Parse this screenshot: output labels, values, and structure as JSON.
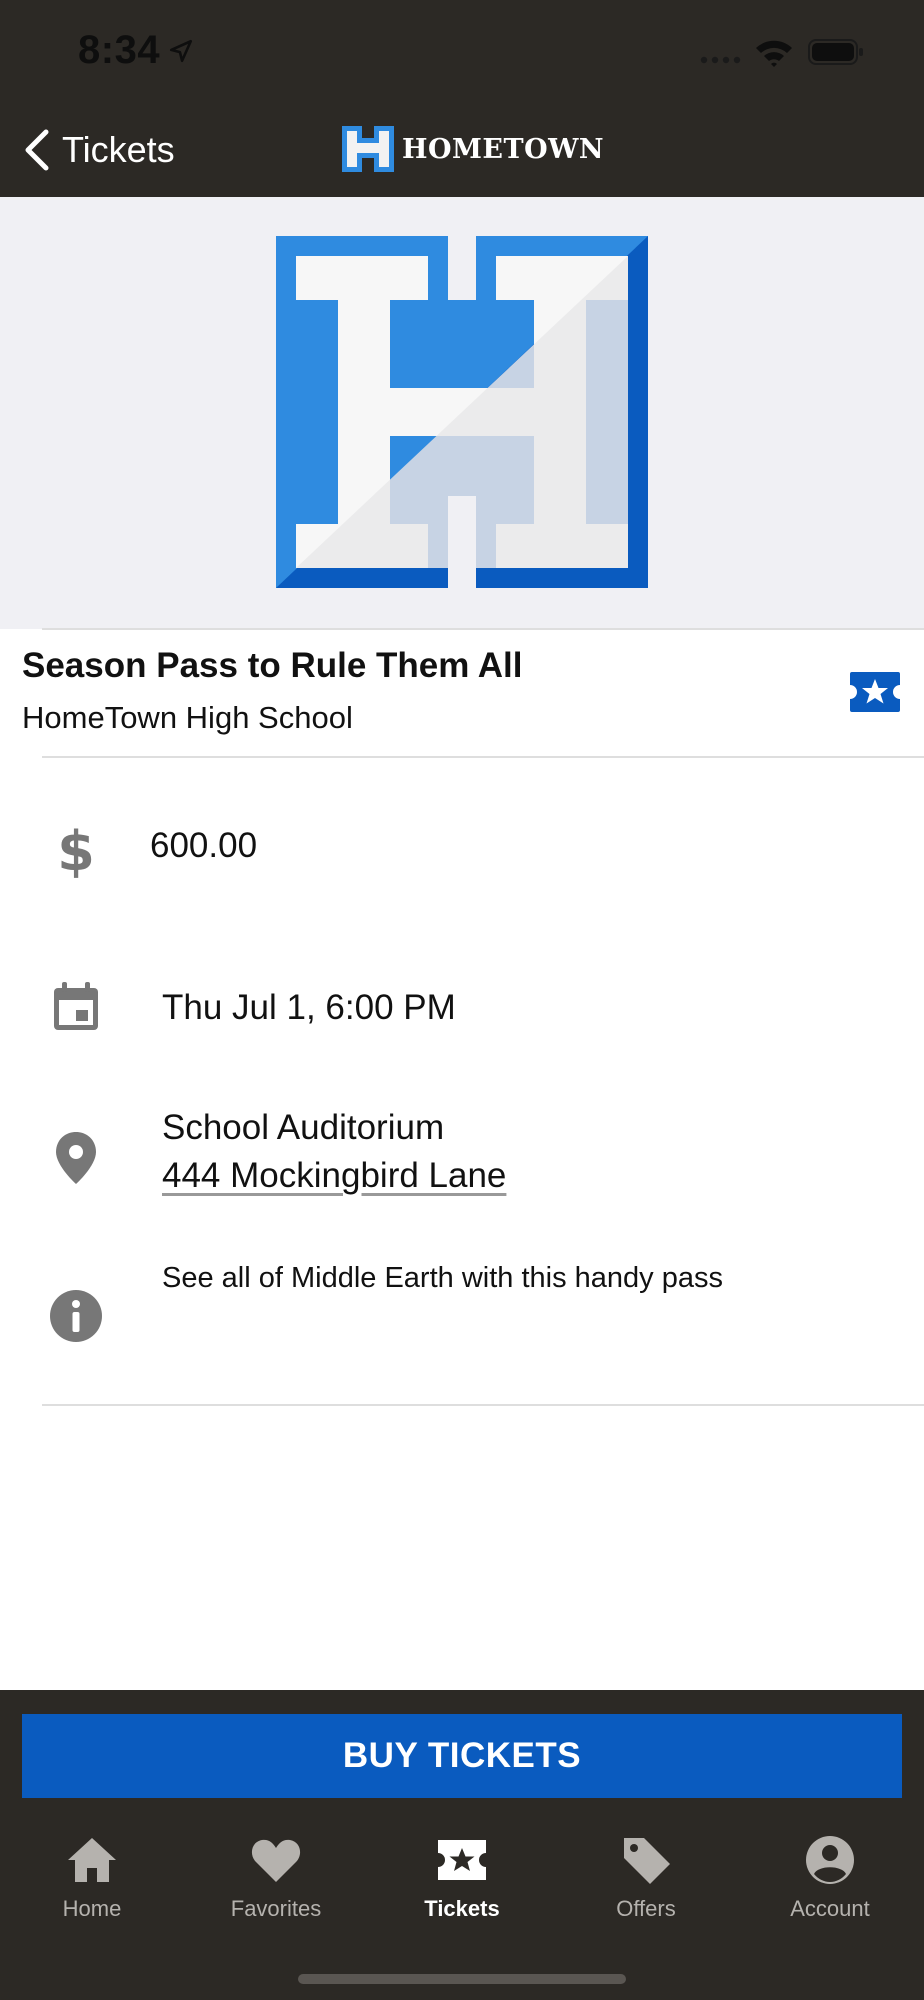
{
  "status_bar": {
    "time": "8:34"
  },
  "nav": {
    "back_label": "Tickets",
    "brand_text": "HOMETOWN"
  },
  "event": {
    "title": "Season Pass to Rule Them All",
    "organization": "HomeTown High School",
    "price": "600.00",
    "datetime": "Thu Jul 1, 6:00 PM",
    "venue": "School Auditorium",
    "address": "444 Mockingbird Lane",
    "description": "See all of Middle Earth with this handy pass"
  },
  "actions": {
    "buy_label": "BUY TICKETS"
  },
  "tabbar": {
    "items": [
      {
        "label": "Home",
        "icon": "home-icon"
      },
      {
        "label": "Favorites",
        "icon": "heart-icon"
      },
      {
        "label": "Tickets",
        "icon": "ticket-icon",
        "active": true
      },
      {
        "label": "Offers",
        "icon": "tag-icon"
      },
      {
        "label": "Account",
        "icon": "account-icon"
      }
    ]
  },
  "colors": {
    "bar_dark": "#2c2925",
    "brand_blue": "#0a5bbf",
    "hero_bg": "#f0f0f4",
    "logo_light_blue": "#2f8be0"
  }
}
